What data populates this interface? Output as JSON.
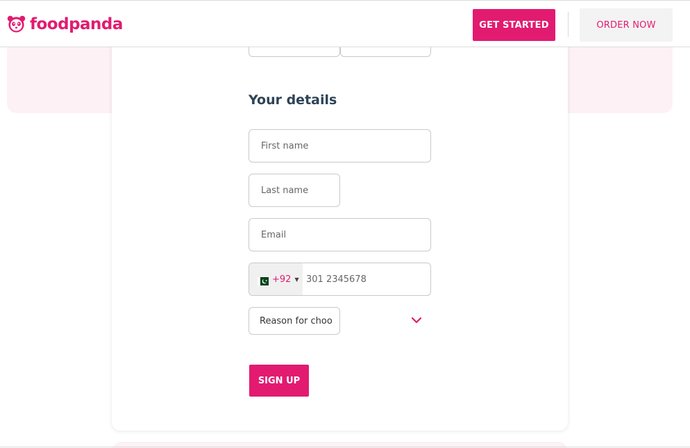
{
  "header": {
    "logo_text": "foodpanda",
    "logo_icon": "panda-logo-icon",
    "get_started_label": "GET STARTED",
    "order_now_label": "ORDER NOW"
  },
  "form": {
    "section_title": "Your details",
    "first_name_placeholder": "First name",
    "last_name_placeholder": "Last name",
    "email_placeholder": "Email",
    "phone": {
      "country_flag": "pakistan-flag-icon",
      "dial_code": "+92",
      "placeholder": "301 2345678"
    },
    "reason_placeholder": "Reason for choo",
    "signup_label": "SIGN UP"
  },
  "colors": {
    "brand": "#e21b70",
    "pink_background": "#fdf1f5",
    "heading": "#2d4356"
  }
}
